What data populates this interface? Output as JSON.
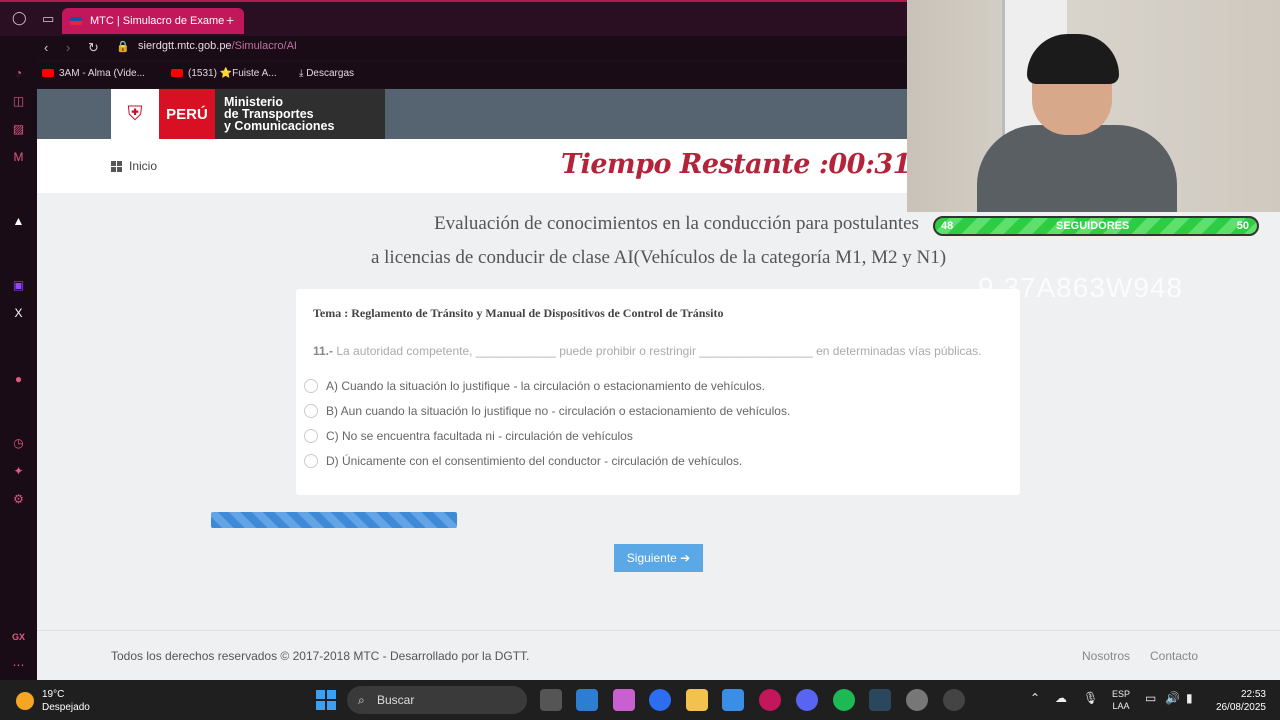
{
  "browser": {
    "tab_title": "MTC | Simulacro de Exame",
    "url_host": "sierdgtt.mtc.gob.pe",
    "url_path": "/Simulacro/AI",
    "bookmarks": [
      "3AM - Alma (Vide...",
      "(1531) ⭐Fuiste A...",
      "Descargas"
    ]
  },
  "header": {
    "logo_country": "PERÚ",
    "logo_ministry_l1": "Ministerio",
    "logo_ministry_l2": "de Transportes",
    "logo_ministry_l3": "y Comunicaciones",
    "nav_home": "Inicio",
    "timer": "Tiempo Restante :00:31:11"
  },
  "exam": {
    "title_l1": "Evaluación de conocimientos en la conducción para postulantes",
    "title_l2": "a licencias de conducir de clase AI(Vehículos de la categoría M1, M2 y N1)",
    "topic": "Tema : Reglamento de Tránsito y Manual de Dispositivos de Control de Tránsito",
    "question_number": "11.-",
    "question_text": "La autoridad competente, ____________ puede prohibir o restringir _________________ en determinadas vías públicas.",
    "options": [
      "A) Cuando la situación lo justifique - la circulación o estacionamiento de vehículos.",
      "B) Aun cuando la situación lo justifique no - circulación o estacionamiento de vehículos.",
      "C) No se encuentra facultada ni - circulación de vehículos",
      "D) Únicamente con el consentimiento del conductor - circulación de vehículos."
    ],
    "next_label": "Siguiente ➔"
  },
  "footer": {
    "copyright": "Todos los derechos reservados © 2017-2018 MTC - Desarrollado por la DGTT.",
    "link_about": "Nosotros",
    "link_contact": "Contacto"
  },
  "overlay": {
    "followers_label": "SEGUIDORES",
    "followers_current": "48",
    "followers_goal": "50",
    "watermark": "9 37A863W948"
  },
  "taskbar": {
    "temp": "19°C",
    "weather": "Despejado",
    "search": "Buscar",
    "lang_l1": "ESP",
    "lang_l2": "LAA",
    "time": "22:53",
    "date": "26/08/2025"
  },
  "colors": {
    "accent": "#c2185b",
    "timer": "#b3243a",
    "button": "#5aa9e6",
    "header": "#556470"
  }
}
